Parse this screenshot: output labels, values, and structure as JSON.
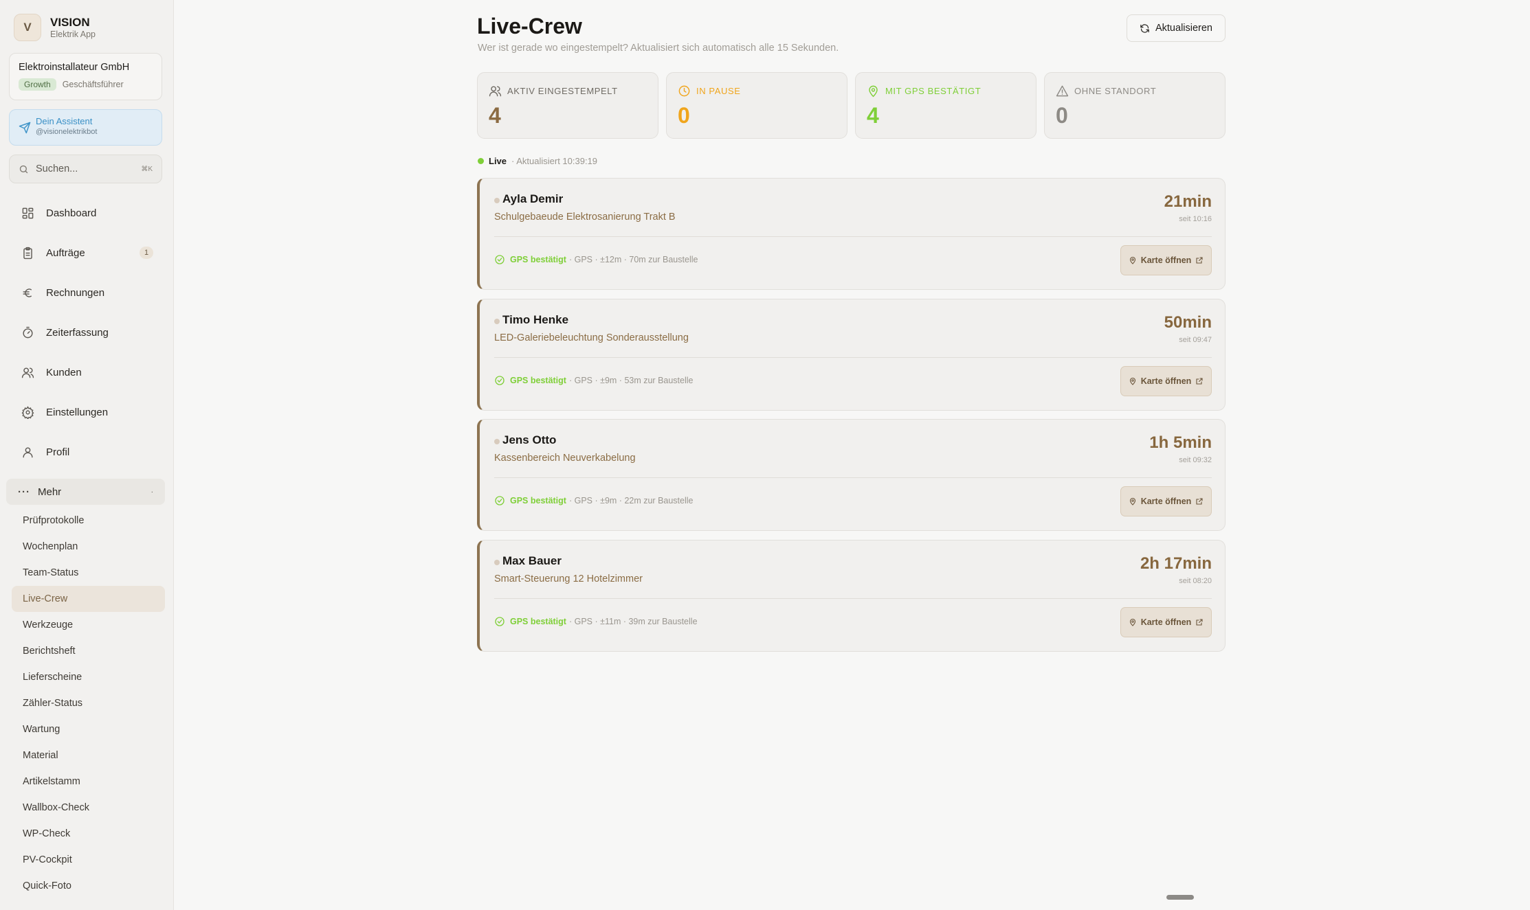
{
  "brand": {
    "logo_letter": "V",
    "name": "VISION",
    "subtitle": "Elektrik App"
  },
  "company": {
    "name": "Elektroinstallateur GmbH",
    "plan": "Growth",
    "role": "Geschäftsführer"
  },
  "assistant": {
    "title": "Dein Assistent",
    "handle": "@visionelektrikbot"
  },
  "search": {
    "placeholder": "Suchen...",
    "shortcut": "⌘K"
  },
  "nav": {
    "items": [
      {
        "label": "Dashboard",
        "icon": "grid-icon"
      },
      {
        "label": "Aufträge",
        "icon": "clipboard-icon",
        "count": "1"
      },
      {
        "label": "Rechnungen",
        "icon": "euro-icon"
      },
      {
        "label": "Zeiterfassung",
        "icon": "stopwatch-icon"
      },
      {
        "label": "Kunden",
        "icon": "users-icon"
      },
      {
        "label": "Einstellungen",
        "icon": "gear-icon"
      },
      {
        "label": "Profil",
        "icon": "user-icon"
      }
    ],
    "more_label": "Mehr",
    "sub_items": [
      "Prüfprotokolle",
      "Wochenplan",
      "Team-Status",
      "Live-Crew",
      "Werkzeuge",
      "Berichtsheft",
      "Lieferscheine",
      "Zähler-Status",
      "Wartung",
      "Material",
      "Artikelstamm",
      "Wallbox-Check",
      "WP-Check",
      "PV-Cockpit",
      "Quick-Foto"
    ],
    "active_sub": "Live-Crew"
  },
  "header": {
    "title": "Live-Crew",
    "subtitle": "Wer ist gerade wo eingestempelt? Aktualisiert sich automatisch alle 15 Sekunden.",
    "refresh_label": "Aktualisieren"
  },
  "stats": [
    {
      "label": "AKTIV EINGESTEMPELT",
      "value": "4",
      "color": "#8b6b42",
      "label_color": "#6f6b64",
      "icon": "users-icon"
    },
    {
      "label": "IN PAUSE",
      "value": "0",
      "color": "#f0a51c",
      "label_color": "#f0a51c",
      "icon": "clock-icon"
    },
    {
      "label": "MIT GPS BESTÄTIGT",
      "value": "4",
      "color": "#7fcf38",
      "label_color": "#7fcf38",
      "icon": "map-pin-icon"
    },
    {
      "label": "OHNE STANDORT",
      "value": "0",
      "color": "#8d8a85",
      "label_color": "#8d8a85",
      "icon": "warning-icon"
    }
  ],
  "live": {
    "label": "Live",
    "updated": "· Aktualisiert 10:39:19"
  },
  "crew": [
    {
      "name": "Ayla Demir",
      "project": "Schulgebaeude Elektrosanierung Trakt B",
      "duration": "21min",
      "since": "seit 10:16",
      "gps_status": "GPS bestätigt",
      "gps_detail": "· GPS · ±12m · 70m zur Baustelle",
      "map_label": "Karte öffnen"
    },
    {
      "name": "Timo Henke",
      "project": "LED-Galeriebeleuchtung Sonderausstellung",
      "duration": "50min",
      "since": "seit 09:47",
      "gps_status": "GPS bestätigt",
      "gps_detail": "· GPS · ±9m · 53m zur Baustelle",
      "map_label": "Karte öffnen"
    },
    {
      "name": "Jens Otto",
      "project": "Kassenbereich Neuverkabelung",
      "duration": "1h 5min",
      "since": "seit 09:32",
      "gps_status": "GPS bestätigt",
      "gps_detail": "· GPS · ±9m · 22m zur Baustelle",
      "map_label": "Karte öffnen"
    },
    {
      "name": "Max Bauer",
      "project": "Smart-Steuerung 12 Hotelzimmer",
      "duration": "2h 17min",
      "since": "seit 08:20",
      "gps_status": "GPS bestätigt",
      "gps_detail": "· GPS · ±11m · 39m zur Baustelle",
      "map_label": "Karte öffnen"
    }
  ]
}
